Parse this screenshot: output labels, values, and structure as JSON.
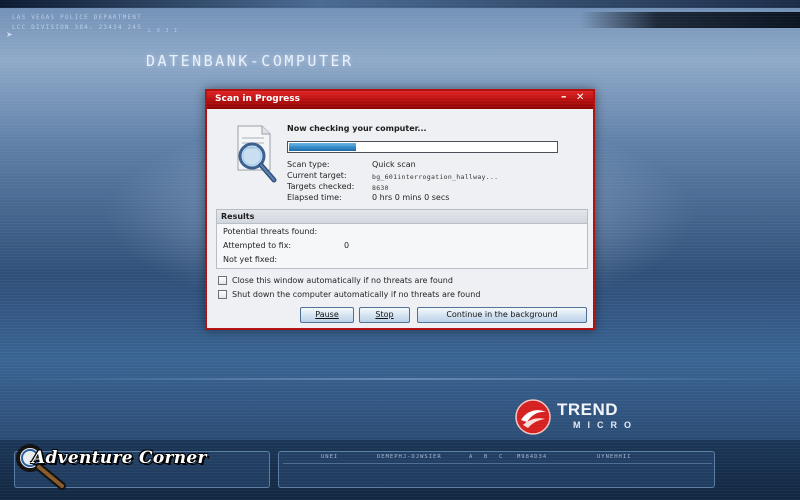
{
  "background": {
    "dept_lines": [
      "LAS VEGAS POLICE DEPARTMENT",
      "LCC DIVISION 384- 23434 245"
    ],
    "screen_title": "DATENBANK-COMPUTER"
  },
  "dialog": {
    "title": "Scan in Progress",
    "minimize_glyph": "–",
    "close_glyph": "✕",
    "heading": "Now checking your computer...",
    "progress": 0.25,
    "info": [
      {
        "label": "Scan type:",
        "value": "Quick scan"
      },
      {
        "label": "Current target:",
        "value": "bg_601interrogation_hallway..."
      },
      {
        "label": "Targets checked:",
        "value": "8630"
      },
      {
        "label": "Elapsed time:",
        "value": "0 hrs 0 mins 0 secs"
      }
    ],
    "results": {
      "title": "Results",
      "rows": [
        {
          "label": "Potential threats found:",
          "value": ""
        },
        {
          "label": "Attempted to fix:",
          "value": "0"
        },
        {
          "label": "Not yet fixed:",
          "value": ""
        }
      ]
    },
    "options": [
      {
        "label": "Close this window automatically if no threats are found",
        "checked": false
      },
      {
        "label": "Shut down the computer automatically if no threats are found",
        "checked": false
      }
    ],
    "buttons": {
      "pause": "Pause",
      "stop": "Stop",
      "background": "Continue in the background"
    }
  },
  "brand": {
    "trend": "TREND",
    "micro": "MICRO",
    "accent_color": "#d62020"
  },
  "bottom_panel": {
    "columns": [
      "UNEI",
      "DEMEPHJ-DJWSIER",
      "A",
      "B",
      "C",
      "M984D34",
      "UYNEHHII"
    ],
    "left_code": "L O J I"
  },
  "watermark": {
    "text": "Adventure Corner"
  },
  "icons": {
    "scan": "magnifier-document-icon",
    "trend": "trend-micro-logo-icon",
    "watermark": "magnifier-icon"
  }
}
